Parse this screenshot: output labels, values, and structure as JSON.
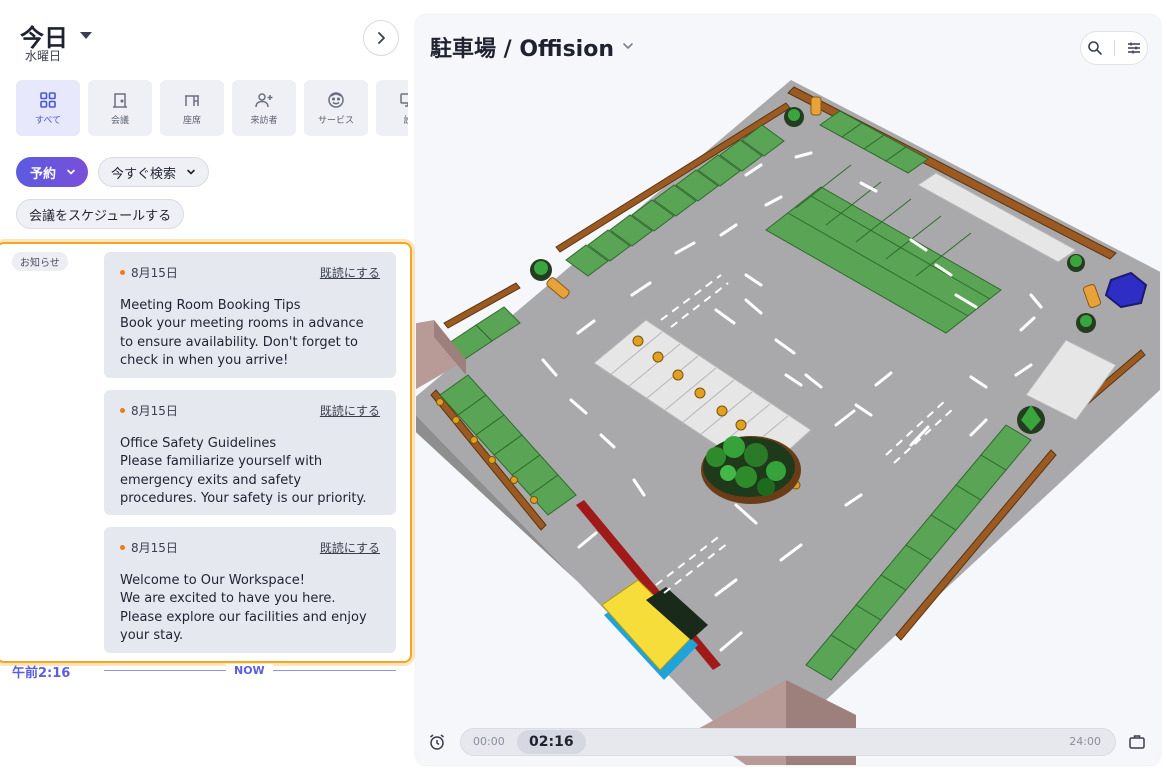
{
  "header": {
    "title": "今日",
    "subtitle": "水曜日"
  },
  "categories": [
    {
      "label": "すべて",
      "icon": "grid-icon",
      "active": true
    },
    {
      "label": "会議",
      "icon": "door-icon",
      "active": false
    },
    {
      "label": "座席",
      "icon": "desk-icon",
      "active": false
    },
    {
      "label": "来訪者",
      "icon": "add-person-icon",
      "active": false
    },
    {
      "label": "サービス",
      "icon": "face-icon",
      "active": false
    },
    {
      "label": "設",
      "icon": "monitor-icon",
      "active": false
    }
  ],
  "actions": {
    "reserve_label": "予約",
    "search_now_label": "今すぐ検索",
    "schedule_label": "会議をスケジュールする"
  },
  "notices": {
    "tag": "お知らせ",
    "mark_read_label": "既読にする",
    "items": [
      {
        "date": "8月15日",
        "title": "Meeting Room Booking Tips",
        "body": "Book your meeting rooms in advance to ensure availability. Don't forget to check in when you arrive!"
      },
      {
        "date": "8月15日",
        "title": "Office Safety Guidelines",
        "body": "Please familiarize yourself with emergency exits and safety procedures. Your safety is our priority."
      },
      {
        "date": "8月15日",
        "title": "Welcome to Our Workspace!",
        "body": "We are excited to have you here. Please explore our facilities and enjoy your stay."
      }
    ]
  },
  "now": {
    "time": "午前2:16",
    "label": "NOW"
  },
  "map": {
    "title": "駐車場 / Offision",
    "accent_color": "#5a5fe0",
    "highlight_color": "#f5a524"
  },
  "timeline": {
    "start": "00:00",
    "current": "02:16",
    "end": "24:00"
  }
}
